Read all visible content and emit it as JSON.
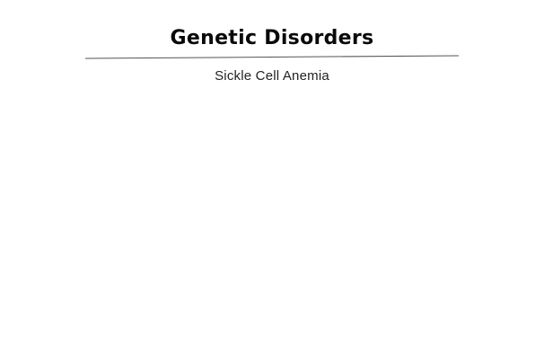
{
  "page": {
    "title": "Genetic Disorders",
    "subtitle": "Sickle Cell Anemia"
  },
  "colors": {
    "background": "#ffffff",
    "title_text": "#0a0a0a",
    "subtitle_text": "#222222",
    "divider": "#555555"
  }
}
